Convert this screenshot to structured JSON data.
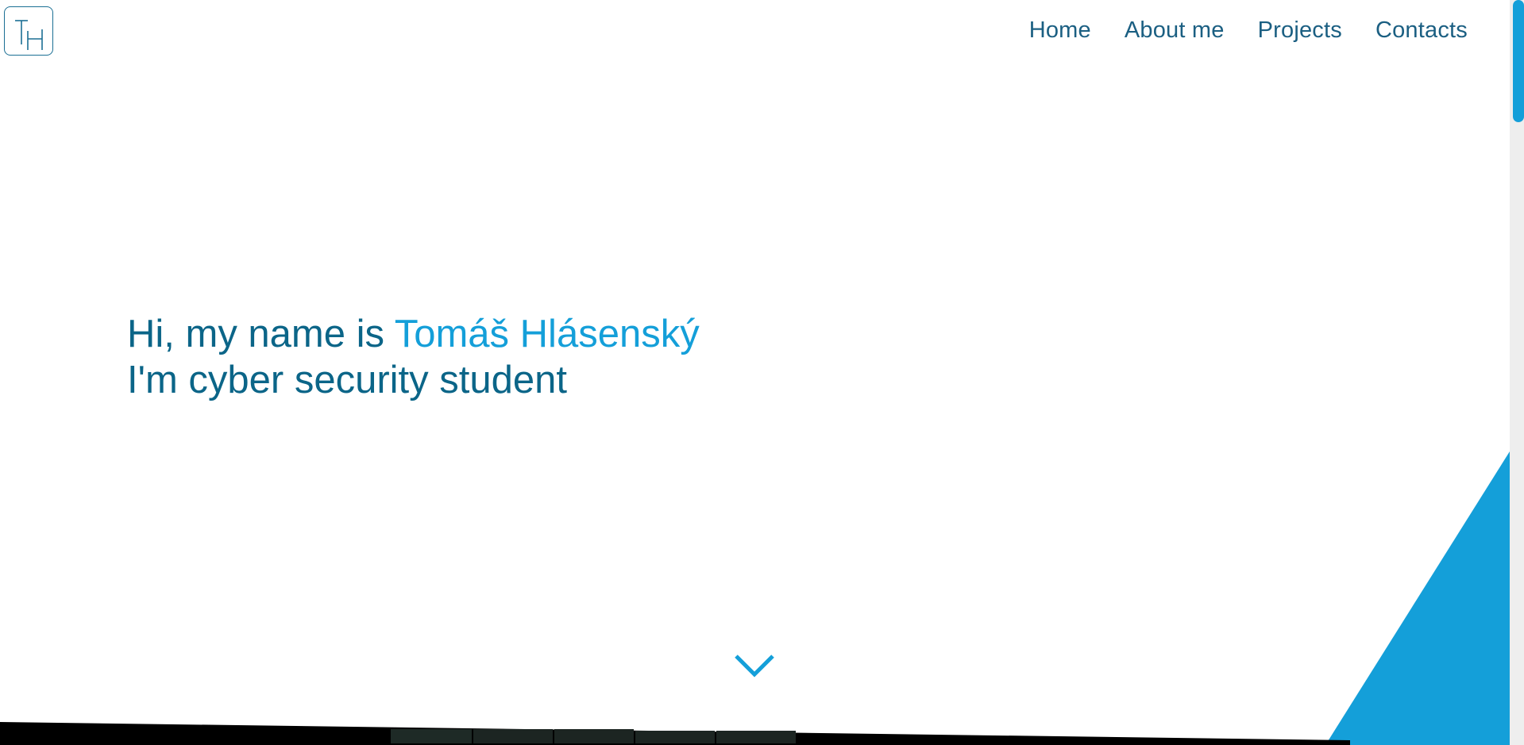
{
  "header": {
    "logo_text": "TH",
    "nav": {
      "home": "Home",
      "about": "About me",
      "projects": "Projects",
      "contacts": "Contacts"
    }
  },
  "hero": {
    "greeting": "Hi, my name is ",
    "name": "Tomáš Hlásenský",
    "subtitle": "I'm cyber security student"
  },
  "icons": {
    "scroll_down": "chevron-down-icon"
  },
  "colors": {
    "accent": "#149fd9",
    "text_dark": "#0b6588",
    "nav_text": "#1b5f82",
    "bottom_strip": "#000000"
  }
}
